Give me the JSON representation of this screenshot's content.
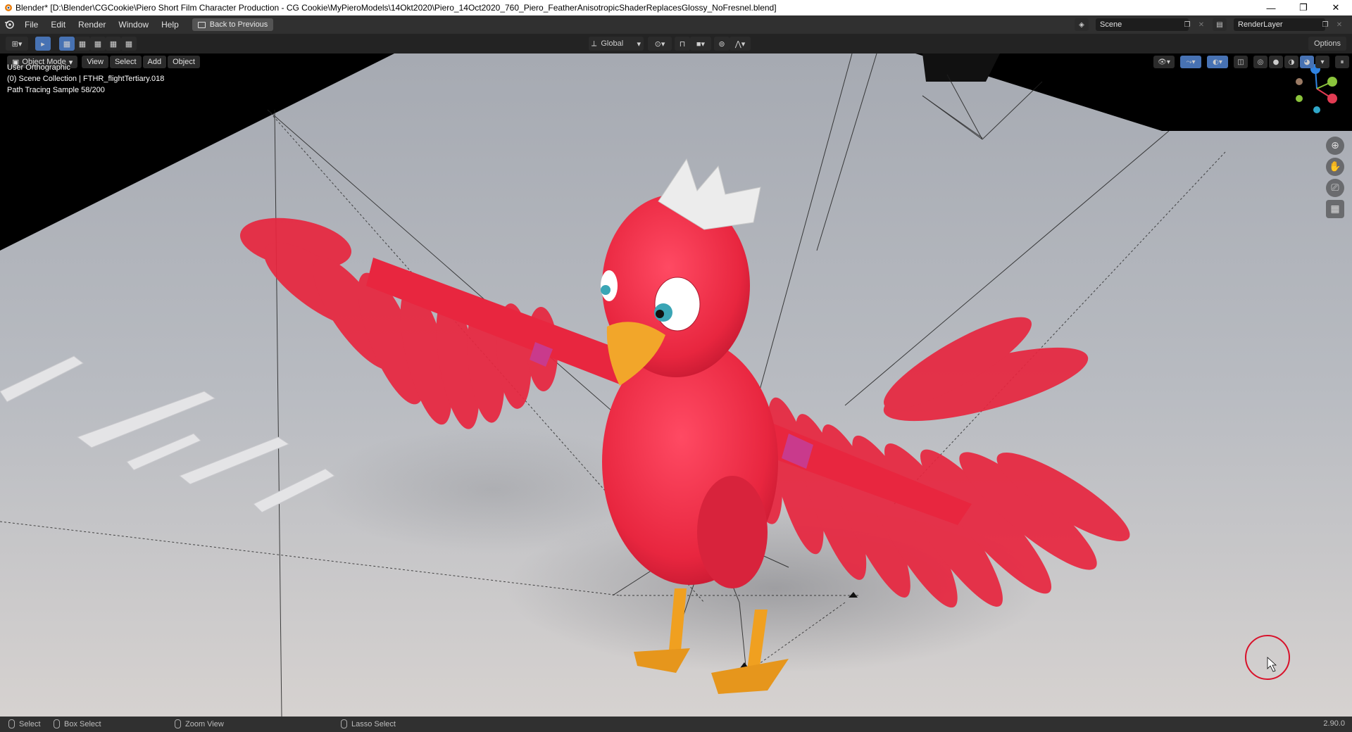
{
  "window": {
    "title": "Blender* [D:\\Blender\\CGCookie\\Piero Short Film Character Production - CG Cookie\\MyPieroModels\\14Okt2020\\Piero_14Oct2020_760_Piero_FeatherAnisotropicShaderReplacesGlossy_NoFresnel.blend]",
    "minimize": "—",
    "restore": "❐",
    "close": "✕"
  },
  "menu": {
    "items": [
      "File",
      "Edit",
      "Render",
      "Window",
      "Help"
    ],
    "back_button": "Back to Previous",
    "scene_label": "Scene",
    "renderlayer_label": "RenderLayer"
  },
  "toolbar": {
    "transform_orientation": "Global",
    "options_label": "Options"
  },
  "header": {
    "mode": "Object Mode",
    "menus": [
      "View",
      "Select",
      "Add",
      "Object"
    ]
  },
  "viewport": {
    "view_name": "User Orthographic",
    "collection_info": "(0) Scene Collection | FTHR_flightTertiary.018",
    "render_status": "Path Tracing Sample 58/200"
  },
  "gizmo": {
    "axis_x": "X",
    "axis_y": "Y",
    "axis_z": "Z"
  },
  "status": {
    "select": "Select",
    "box_select": "Box Select",
    "zoom_view": "Zoom View",
    "lasso_select": "Lasso Select",
    "version": "2.90.0"
  },
  "colors": {
    "bird_red": "#e8263f",
    "accent_blue": "#4772b3",
    "cursor_ring": "#d8112a"
  }
}
